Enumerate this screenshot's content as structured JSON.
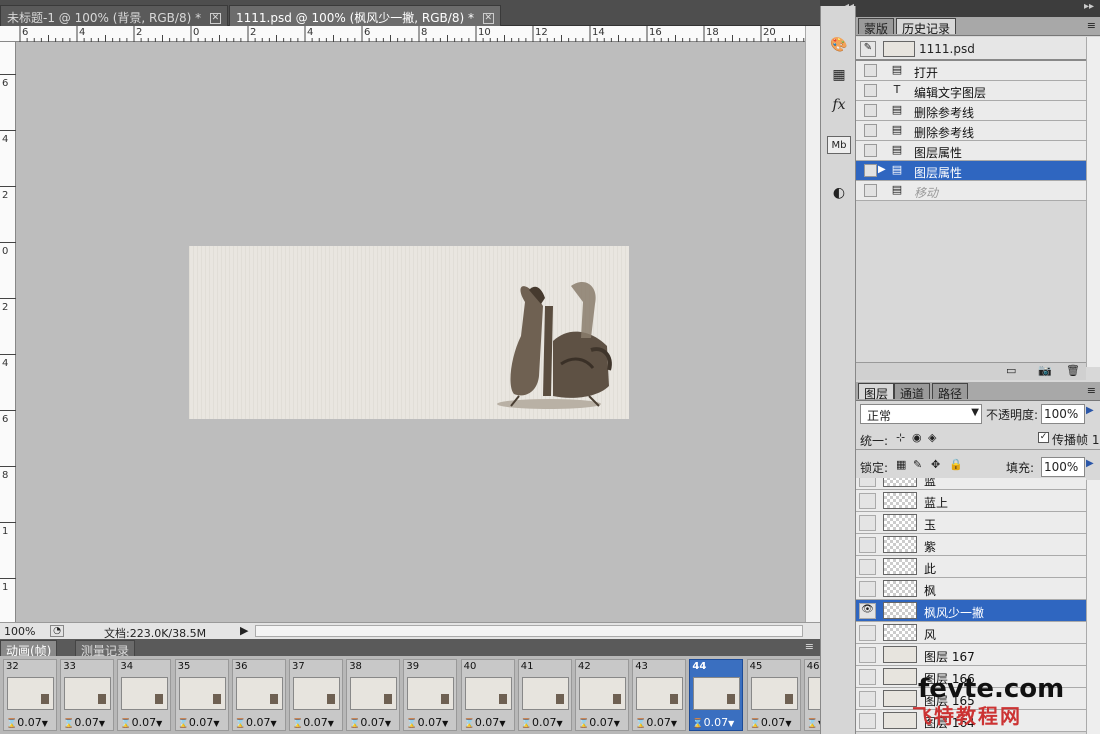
{
  "doc_tabs": [
    {
      "title": "未标题-1 @ 100% (背景, RGB/8) *"
    },
    {
      "title": "1111.psd @ 100% (枫风少一撇, RGB/8) *"
    }
  ],
  "ruler_top_labels": [
    "6",
    "4",
    "2",
    "0",
    "2",
    "4",
    "6",
    "8",
    "10",
    "12",
    "14",
    "16",
    "18",
    "20"
  ],
  "ruler_left_labels": [
    "6",
    "4",
    "2",
    "0",
    "2",
    "4",
    "6",
    "8",
    "1",
    "1",
    "1"
  ],
  "status": {
    "zoom": "100%",
    "doc_info": "文档:223.0K/38.5M"
  },
  "animation_panel": {
    "tabs": [
      "动画(帧)",
      "测量记录"
    ],
    "frames": [
      {
        "num": "32",
        "time": "0.07"
      },
      {
        "num": "33",
        "time": "0.07"
      },
      {
        "num": "34",
        "time": "0.07"
      },
      {
        "num": "35",
        "time": "0.07"
      },
      {
        "num": "36",
        "time": "0.07"
      },
      {
        "num": "37",
        "time": "0.07"
      },
      {
        "num": "38",
        "time": "0.07"
      },
      {
        "num": "39",
        "time": "0.07"
      },
      {
        "num": "40",
        "time": "0.07"
      },
      {
        "num": "41",
        "time": "0.07"
      },
      {
        "num": "42",
        "time": "0.07"
      },
      {
        "num": "43",
        "time": "0.07"
      },
      {
        "num": "44",
        "time": "0.07",
        "selected": true
      },
      {
        "num": "45",
        "time": "0.07"
      },
      {
        "num": "46",
        "time": ""
      }
    ]
  },
  "history_panel": {
    "tabs": [
      "蒙版",
      "历史记录"
    ],
    "snapshot": "1111.psd",
    "items": [
      {
        "label": "打开",
        "icon": "doc-icon"
      },
      {
        "label": "编辑文字图层",
        "icon": "text-icon"
      },
      {
        "label": "删除参考线",
        "icon": "doc-icon"
      },
      {
        "label": "删除参考线",
        "icon": "doc-icon"
      },
      {
        "label": "图层属性",
        "icon": "doc-icon"
      },
      {
        "label": "图层属性",
        "icon": "doc-icon",
        "selected": true
      },
      {
        "label": "移动",
        "icon": "doc-icon",
        "dim": true
      }
    ]
  },
  "layers_panel": {
    "tabs": [
      "图层",
      "通道",
      "路径"
    ],
    "blend_mode": "正常",
    "opacity_label": "不透明度:",
    "opacity_value": "100%",
    "unify_label": "统一:",
    "propagate_label": "传播帧 1",
    "lock_label": "锁定:",
    "fill_label": "填充:",
    "fill_value": "100%",
    "layers": [
      {
        "name": "蓝",
        "visible": false,
        "thumb": "checker"
      },
      {
        "name": "蓝上",
        "visible": false,
        "thumb": "checker"
      },
      {
        "name": "玉",
        "visible": false,
        "thumb": "checker"
      },
      {
        "name": "紫",
        "visible": false,
        "thumb": "checker"
      },
      {
        "name": "此",
        "visible": false,
        "thumb": "checker"
      },
      {
        "name": "枫",
        "visible": false,
        "thumb": "checker"
      },
      {
        "name": "枫风少一撇",
        "visible": true,
        "thumb": "checker",
        "selected": true
      },
      {
        "name": "风",
        "visible": false,
        "thumb": "checker"
      },
      {
        "name": "图层 167",
        "visible": false,
        "thumb": "image"
      },
      {
        "name": "图层 166",
        "visible": false,
        "thumb": "image"
      },
      {
        "name": "图层 165",
        "visible": false,
        "thumb": "image"
      },
      {
        "name": "图层 164",
        "visible": false,
        "thumb": "image"
      }
    ]
  },
  "watermark": {
    "line1": "fevte.com",
    "line2": "飞特教程网"
  }
}
